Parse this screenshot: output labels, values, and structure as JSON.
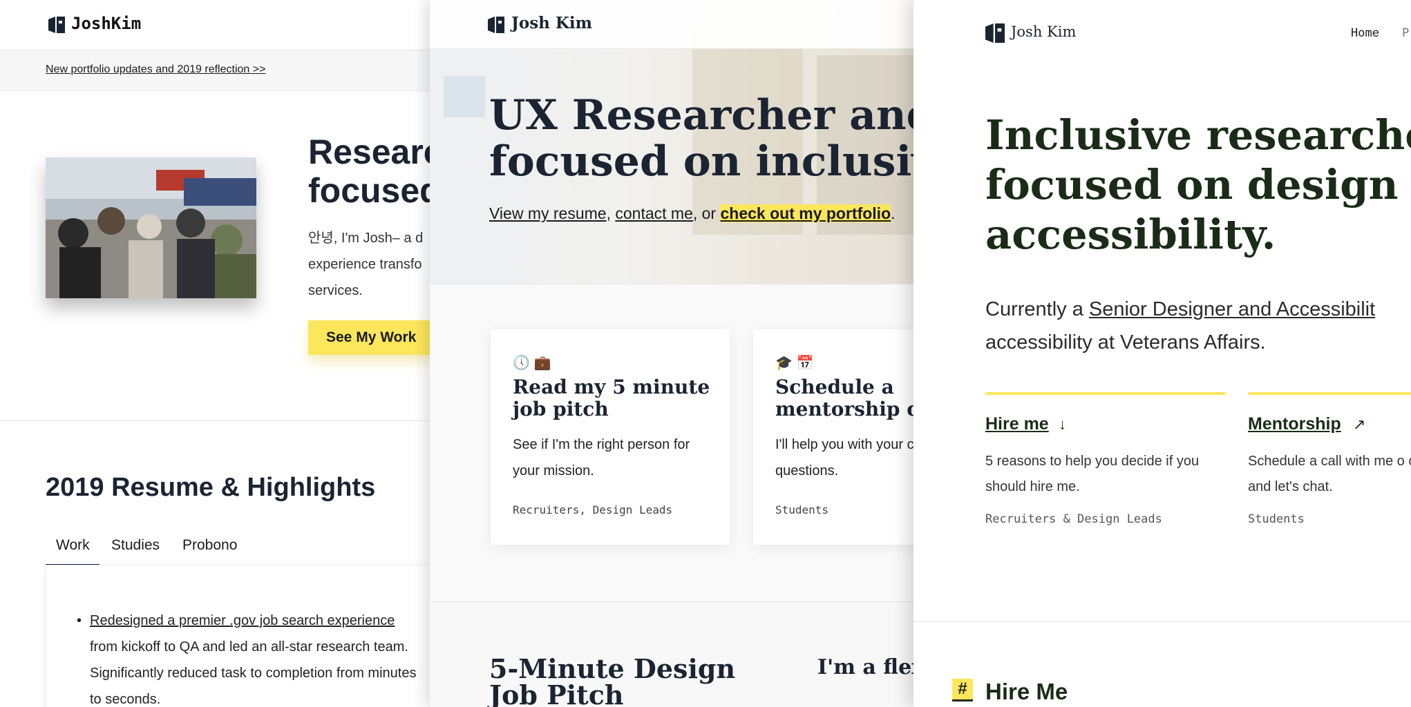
{
  "panel1": {
    "logo_text": "JoshKim",
    "announcement": "New portfolio updates and 2019 reflection >>",
    "hero_title_line1": "Researc",
    "hero_title_line2": "focused",
    "hero_body_line1": "안녕, I'm Josh– a d",
    "hero_body_line2": "experience transfo",
    "hero_body_line3": "services.",
    "cta_label": "See My Work",
    "resume_title": "2019 Resume & Highlights",
    "tabs": [
      "Work",
      "Studies",
      "Probono"
    ],
    "bullet_link": "Redesigned a premier .gov job search experience",
    "bullet_rest": "from kickoff to QA and led an all-star research team. Significantly reduced task to completion from minutes to seconds."
  },
  "panel2": {
    "logo_text": "Josh Kim",
    "hero_title_line1": "UX Researcher and De",
    "hero_title_line2": "focused on inclusive d",
    "link_resume": "View my resume",
    "sep1": ", ",
    "link_contact": "contact me",
    "sep2": ", or ",
    "link_portfolio": "check out my portfolio",
    "end": ".",
    "cards": [
      {
        "emoji": "🕔 💼",
        "title": "Read my 5 minute job pitch",
        "body": "See if I'm the right person for your mission.",
        "tags": "Recruiters, Design Leads"
      },
      {
        "emoji": "🎓 📅",
        "title": "Schedule a mentorship ca",
        "body": "I'll help you with your career questions.",
        "tags": "Students"
      }
    ],
    "pitch_title": "5-Minute Design Job Pitch",
    "flex_title": "I'm a flexi chops."
  },
  "panel3": {
    "logo_text": "Josh Kim",
    "nav_home": "Home",
    "nav_next": "P",
    "hero_title_line1": "Inclusive researcher a",
    "hero_title_line2": "focused on design ethi",
    "hero_title_line3": "accessibility.",
    "body_pre": "Currently a ",
    "body_link": "Senior Designer and Accessibilit",
    "body_line2": "accessibility at Veterans Affairs.",
    "hire_link": "Hire me",
    "hire_arrow": "↓",
    "hire_body": "5 reasons to help you decide if you should hire me.",
    "hire_tag": "Recruiters & Design Leads",
    "mentor_link": "Mentorship",
    "mentor_arrow": "↗",
    "mentor_body": "Schedule a call with me o calendly and let's chat.",
    "mentor_tag": "Students",
    "section_hash": "#",
    "section_title": "Hire Me"
  },
  "colors": {
    "accent_yellow": "#fce65c",
    "navy": "#1b2432",
    "forest": "#1a2c17"
  }
}
